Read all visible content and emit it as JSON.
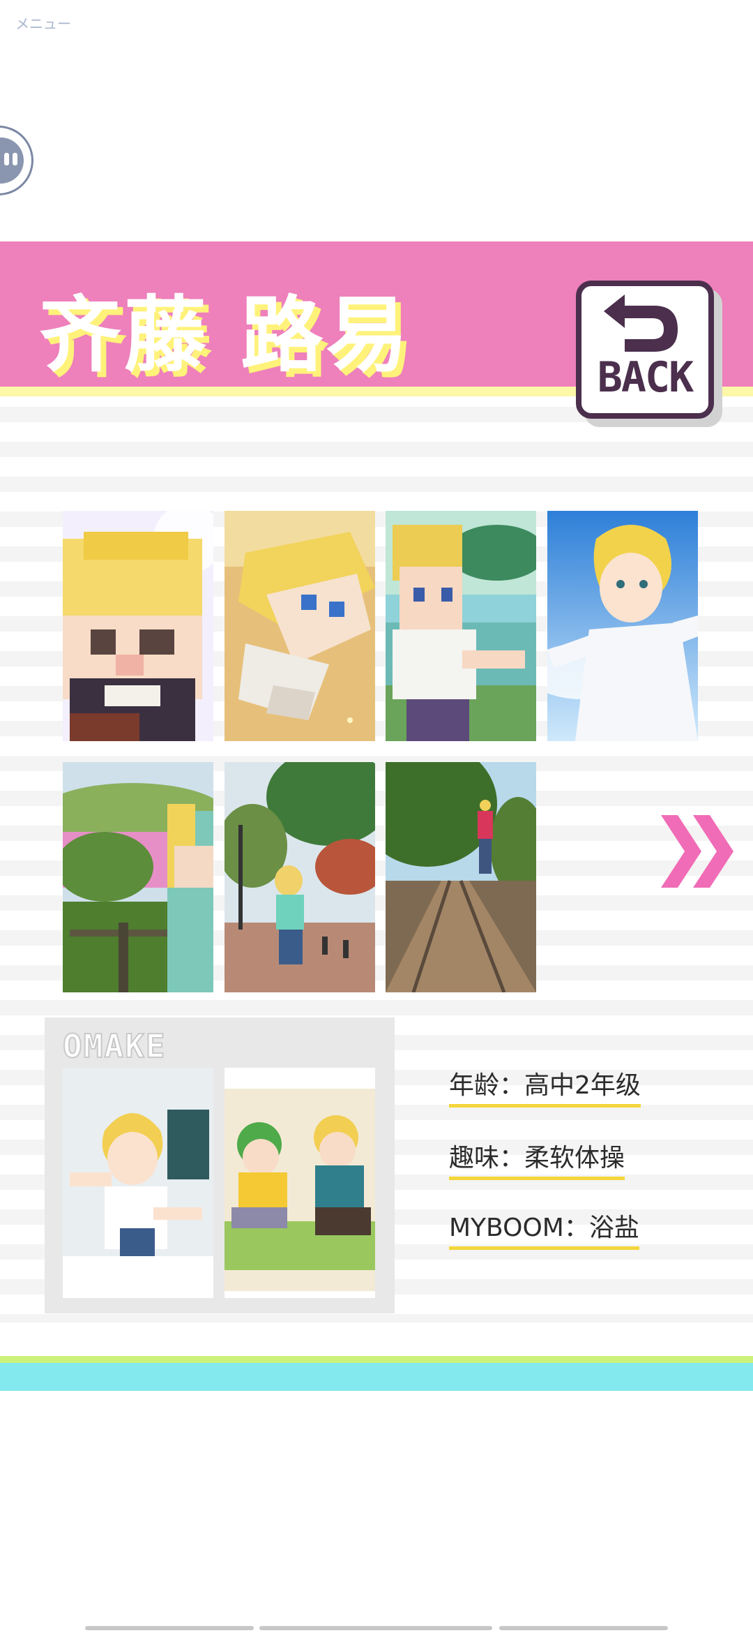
{
  "menu": {
    "label": "メニュー"
  },
  "profile": {
    "name": "齐藤 路易",
    "back_label": "BACK"
  },
  "gallery": {
    "items": [
      {
        "name": "pixel-portrait-closeup"
      },
      {
        "name": "pixel-portrait-tilted"
      },
      {
        "name": "pixel-scene-lake"
      },
      {
        "name": "illustration-bright-sky"
      },
      {
        "name": "photo-pink-flowers"
      },
      {
        "name": "photo-park-trees"
      },
      {
        "name": "photo-railway-tracks"
      }
    ]
  },
  "omake": {
    "title": "OMAKE"
  },
  "info": {
    "age": "年龄：高中2年级",
    "hobby": "趣味：柔软体操",
    "myboom": "MYBOOM：浴盐"
  },
  "colors": {
    "header_pink": "#ee80bb",
    "title_shadow_yellow": "#fff27a",
    "back_dark": "#4b2f4d",
    "arrow_pink": "#f06cb6",
    "underline_yellow": "#f4d63a",
    "footer_green": "#cdf27c",
    "footer_cyan": "#84e9ef"
  }
}
